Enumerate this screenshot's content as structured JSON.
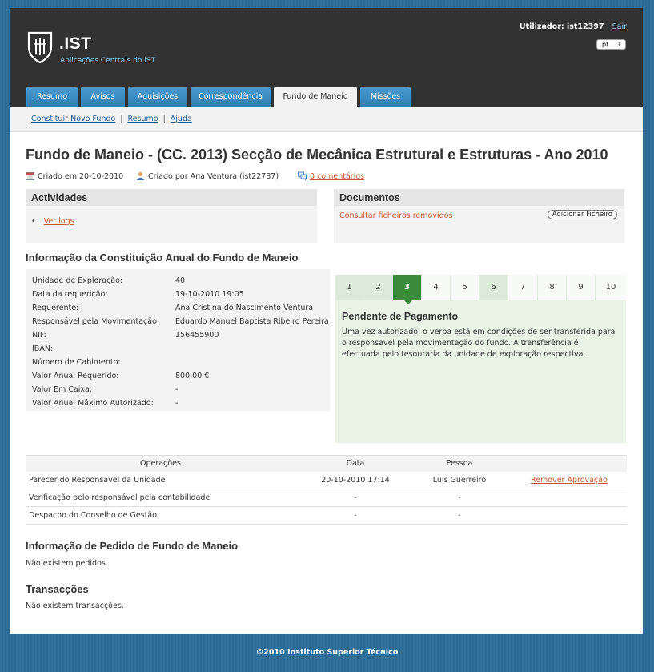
{
  "header": {
    "brand": ".IST",
    "brand_sub": "Aplicações Centrais do IST",
    "user_label": "Utilizador: ist12397",
    "user_sep": "|",
    "logout": "Sair",
    "lang_value": "pt"
  },
  "tabs": [
    {
      "label": "Resumo"
    },
    {
      "label": "Avisos"
    },
    {
      "label": "Aquisições"
    },
    {
      "label": "Correspondência"
    },
    {
      "label": "Fundo de Maneio",
      "active": true
    },
    {
      "label": "Missões"
    }
  ],
  "subnav": {
    "items": [
      "Constituir Novo Fundo",
      "Resumo",
      "Ajuda"
    ],
    "sep": "|"
  },
  "page": {
    "title": "Fundo de Maneio - (CC. 2013) Secção de Mecânica Estrutural e Estruturas - Ano 2010",
    "created_on": "Criado em 20-10-2010",
    "created_by": "Criado por Ana Ventura (ist22787)",
    "comments": "0 comentários"
  },
  "activities": {
    "title": "Actividades",
    "bullet": "•",
    "link": "Ver logs"
  },
  "documents": {
    "title": "Documentos",
    "link": "Consultar ficheiros removidos",
    "add_button": "Adicionar Ficheiro"
  },
  "info": {
    "title": "Informação da Constituição Anual do Fundo de Maneio",
    "rows": [
      {
        "k": "Unidade de Exploração:",
        "v": "40"
      },
      {
        "k": "Data da requerição:",
        "v": "19-10-2010 19:05"
      },
      {
        "k": "Requerente:",
        "v": "Ana Cristina do Nascimento Ventura"
      },
      {
        "k": "Responsável pela Movimentação:",
        "v": "Eduardo Manuel Baptista Ribeiro Pereira"
      },
      {
        "k": "NIF:",
        "v": "156455900"
      },
      {
        "k": "IBAN:",
        "v": ""
      },
      {
        "k": "Número de Cabimento:",
        "v": ""
      },
      {
        "k": "Valor Anual Requerido:",
        "v": "800,00 €"
      },
      {
        "k": "Valor Em Caixa:",
        "v": "-"
      },
      {
        "k": "Valor Anual Máximo Autorizado:",
        "v": "-"
      }
    ]
  },
  "process": {
    "steps": [
      "1",
      "2",
      "3",
      "4",
      "5",
      "6",
      "7",
      "8",
      "9",
      "10"
    ],
    "current_step": 3,
    "state_title": "Pendente de Pagamento",
    "state_desc": "Uma vez autorizado, o verba está em condições de ser transferida para o responsavel pela movimentação do fundo. A transferência é efectuada pelo tesouraria da unidade de exploração respectiva."
  },
  "operations": {
    "headers": [
      "Operações",
      "Data",
      "Pessoa",
      ""
    ],
    "rows": [
      {
        "op": "Parecer do Responsável da Unidade",
        "date": "20-10-2010 17:14",
        "person": "Luis Guerreiro",
        "action": "Remover Aprovação"
      },
      {
        "op": "Verificação pelo responsável pela contabilidade",
        "date": "-",
        "person": "-",
        "action": ""
      },
      {
        "op": "Despacho do Conselho de Gestão",
        "date": "-",
        "person": "-",
        "action": ""
      }
    ]
  },
  "requests": {
    "title": "Informação de Pedido de Fundo de Maneio",
    "empty": "Não existem pedidos."
  },
  "transactions": {
    "title": "Transacções",
    "empty": "Não existem transacções."
  },
  "footer": {
    "text": "©2010 Instituto Superior Técnico"
  },
  "colors": {
    "tab_blue": "#3d8fc6",
    "header_dark": "#323232",
    "link_orange": "#c8552a",
    "step_current": "#3a8c3a",
    "step_panel": "#e8f3e6"
  }
}
